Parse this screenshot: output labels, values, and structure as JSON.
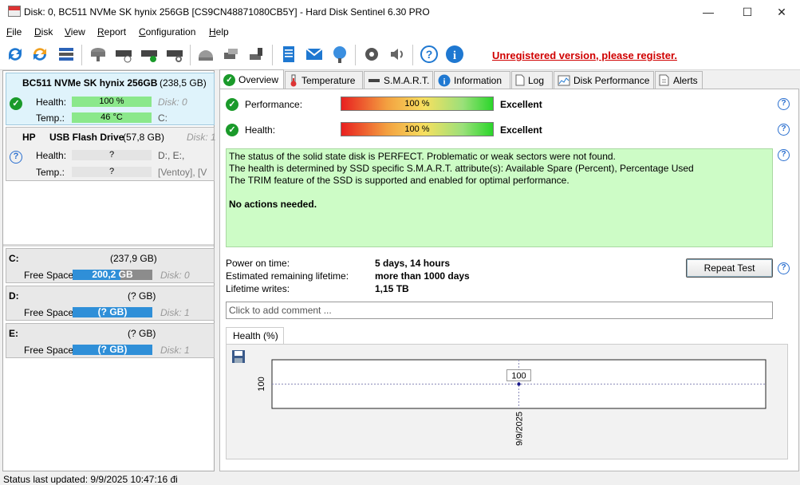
{
  "window": {
    "title": "Disk: 0, BC511 NVMe SK hynix 256GB [CS9CN48871080CB5Y]  -  Hard Disk Sentinel 6.30 PRO",
    "minimize": "—",
    "maximize": "☐",
    "close": "✕"
  },
  "menu": [
    "File",
    "Disk",
    "View",
    "Report",
    "Configuration",
    "Help"
  ],
  "toolbar": {
    "unregistered": "Unregistered version, please register."
  },
  "disks": [
    {
      "model_bold": "BC511 NVMe SK hynix 256GB",
      "size": "(238,5 GB)",
      "health_label": "Health:",
      "health_value": "100 %",
      "health_extra": "Disk: 0",
      "temp_label": "Temp.:",
      "temp_value": "46 °C",
      "temp_extra": "C:"
    },
    {
      "brand": "HP",
      "model_bold": "USB Flash Drive",
      "size": "(57,8 GB)",
      "disk_label": "Disk: 1",
      "health_label": "Health:",
      "health_value": "?",
      "health_extra": "D:, E:,",
      "temp_label": "Temp.:",
      "temp_value": "?",
      "temp_extra": "[Ventoy], [V"
    }
  ],
  "volumes": [
    {
      "name": "C:",
      "size": "(237,9 GB)",
      "free_label": "Free Space",
      "free_value": "200,2 GB",
      "disk": "Disk: 0"
    },
    {
      "name": "D:",
      "size": "(? GB)",
      "free_label": "Free Space",
      "free_value": "(? GB)",
      "disk": "Disk: 1"
    },
    {
      "name": "E:",
      "size": "(? GB)",
      "free_label": "Free Space",
      "free_value": "(? GB)",
      "disk": "Disk: 1"
    }
  ],
  "tabs": [
    "Overview",
    "Temperature",
    "S.M.A.R.T.",
    "Information",
    "Log",
    "Disk Performance",
    "Alerts"
  ],
  "overview": {
    "performance_label": "Performance:",
    "performance_value": "100 %",
    "performance_rating": "Excellent",
    "health_label": "Health:",
    "health_value": "100 %",
    "health_rating": "Excellent",
    "status_lines": [
      "The status of the solid state disk is PERFECT. Problematic or weak sectors were not found.",
      "The health is determined by SSD specific S.M.A.R.T. attribute(s):  Available Spare (Percent), Percentage Used",
      "The TRIM feature of the SSD is supported and enabled for optimal performance."
    ],
    "status_action": "No actions needed.",
    "power_on_label": "Power on time:",
    "power_on_value": "5 days, 14 hours",
    "lifetime_label": "Estimated remaining lifetime:",
    "lifetime_value": "more than 1000 days",
    "writes_label": "Lifetime writes:",
    "writes_value": "1,15 TB",
    "repeat_test": "Repeat Test",
    "comment_placeholder": "Click to add comment ...",
    "graph_tab": "Health (%)"
  },
  "chart_data": {
    "type": "line",
    "x": [
      "9/9/2025"
    ],
    "series": [
      {
        "values": [
          100
        ]
      }
    ],
    "y_tick": "100",
    "point_label": "100"
  },
  "status_bar": "Status last updated: 9/9/2025 10:47:16 đi"
}
